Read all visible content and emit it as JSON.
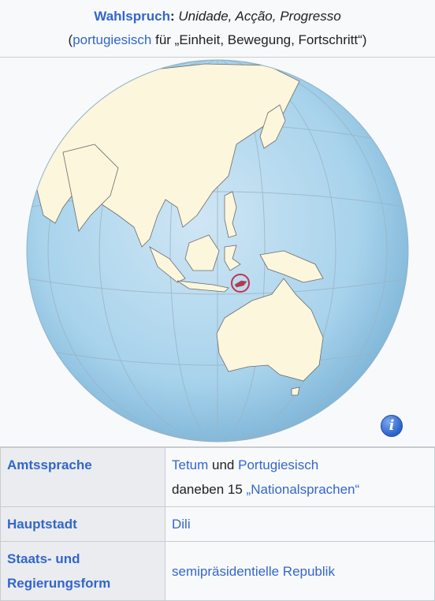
{
  "motto": {
    "label": "Wahlspruch",
    "colon": ":",
    "text": "Unidade, Acção, Progresso",
    "paren_open": "(",
    "lang_link": "portugiesisch",
    "translation": " für „Einheit, Bewegung, Fortschritt“)"
  },
  "map": {
    "info_icon_glyph": "i",
    "ocean_color": "#a8d3ec",
    "land_color": "#fbf6dc",
    "highlight_color": "#c0334d"
  },
  "rows": [
    {
      "label": "Amtssprache",
      "value_parts": {
        "link1": "Tetum",
        "mid": " und ",
        "link2": "Portugiesisch",
        "line2_prefix": "daneben 15 ",
        "link3": "„Nationalsprachen“"
      }
    },
    {
      "label": "Hauptstadt",
      "value": "Dili"
    },
    {
      "label_line1": "Staats- und",
      "label_line2": "Regierungsform",
      "value": "semipräsidentielle Republik"
    }
  ]
}
